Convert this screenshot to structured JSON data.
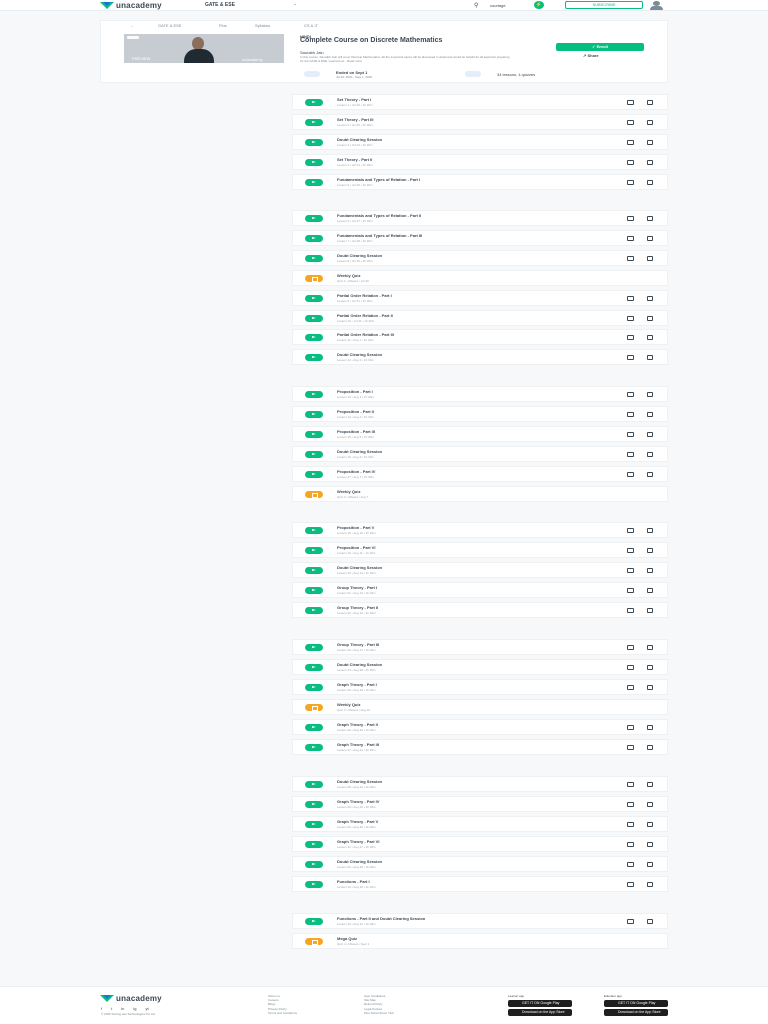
{
  "header": {
    "logo_text": "unacademy",
    "goal": "GATE & ESE",
    "goal_chevron": "⌄",
    "search_placeholder": "courtage",
    "subscribe_label": "SUBSCRIBE"
  },
  "breadcrumbs": [
    "←",
    "GATE & ESE",
    "Plus",
    "Syllabus",
    "CS & IT"
  ],
  "course": {
    "thumb_preview": "PREVIEW",
    "thumb_brand": "unacademy",
    "language": "HINDI",
    "title": "Complete Course on Discrete Mathematics",
    "author": "Saurabh Jain",
    "description": "In this course, Saurabh Jain will cover Discrete Mathematics. All the important topics will be discussed in detail and would be helpful for all aspirants preparing for the GATE & ESE. Learners at... Read more",
    "enroll_label": "Enroll",
    "share_label": "Share",
    "ended_label": "Ended on Sept 1",
    "ended_sub": "Jul 20, 2020 - Sept 1, 2020",
    "lessons_label": "34 lessons, 4 quizzes"
  },
  "groups": [
    [
      {
        "type": "video",
        "title": "Set Theory - Part I",
        "sub": "Lesson 1  •  Jul 20  •  1h 30m"
      },
      {
        "type": "video",
        "title": "Set Theory - Part III",
        "sub": "Lesson 2  •  Jul 20  •  1h 30m"
      },
      {
        "type": "video",
        "title": "Doubt Clearing Session",
        "sub": "Lesson 3  •  Jul 23  •  1h 30m"
      },
      {
        "type": "video",
        "title": "Set Theory - Part II",
        "sub": "Lesson 4  •  Jul 24  •  1h 30m"
      },
      {
        "type": "video",
        "title": "Fundamentals and Types of Relation - Part I",
        "sub": "Lesson 5  •  Jul 26  •  1h 30m"
      }
    ],
    [
      {
        "type": "video",
        "title": "Fundamentals and Types of Relation - Part II",
        "sub": "Lesson 6  •  Jul 27  •  1h 30m"
      },
      {
        "type": "video",
        "title": "Fundamentals and Types of Relation - Part III",
        "sub": "Lesson 7  •  Jul 28  •  1h 30m"
      },
      {
        "type": "video",
        "title": "Doubt Clearing Session",
        "sub": "Lesson 8  •  Jul 30  •  1h 30m"
      },
      {
        "type": "quiz",
        "title": "Weekly Quiz",
        "sub": "Quiz 1  •  Missed  •  Jul 30"
      },
      {
        "type": "video",
        "title": "Partial Order Relation - Part I",
        "sub": "Lesson 9  •  Jul 31  •  1h 30m"
      },
      {
        "type": "video",
        "title": "Partial Order Relation - Part II",
        "sub": "Lesson 10  •  Jul 31  •  1h 30m"
      },
      {
        "type": "video",
        "title": "Partial Order Relation - Part III",
        "sub": "Lesson 11  •  Aug 1  •  1h 30m"
      },
      {
        "type": "video",
        "title": "Doubt Clearing Session",
        "sub": "Lesson 12  •  Aug 2  •  1h 30m"
      }
    ],
    [
      {
        "type": "video",
        "title": "Proposition - Part I",
        "sub": "Lesson 13  •  Aug 3  •  1h 30m"
      },
      {
        "type": "video",
        "title": "Proposition - Part II",
        "sub": "Lesson 14  •  Aug 4  •  1h 30m"
      },
      {
        "type": "video",
        "title": "Proposition - Part III",
        "sub": "Lesson 15  •  Aug 5  •  1h 30m"
      },
      {
        "type": "video",
        "title": "Doubt Clearing Session",
        "sub": "Lesson 16  •  Aug 6  •  1h 30m"
      },
      {
        "type": "video",
        "title": "Proposition - Part IV",
        "sub": "Lesson 17  •  Aug 7  •  1h 30m"
      },
      {
        "type": "quiz",
        "title": "Weekly Quiz",
        "sub": "Quiz 2  •  Missed  •  Aug 7"
      }
    ],
    [
      {
        "type": "video",
        "title": "Proposition - Part V",
        "sub": "Lesson 18  •  Aug 10  •  1h 30m"
      },
      {
        "type": "video",
        "title": "Proposition - Part VI",
        "sub": "Lesson 19  •  Aug 11  •  1h 30m"
      },
      {
        "type": "video",
        "title": "Doubt Clearing Session",
        "sub": "Lesson 20  •  Aug 13  •  1h 30m"
      },
      {
        "type": "video",
        "title": "Group Theory - Part I",
        "sub": "Lesson 21  •  Aug 14  •  1h 30m"
      },
      {
        "type": "video",
        "title": "Group Theory - Part II",
        "sub": "Lesson 22  •  Aug 14  •  1h 30m"
      }
    ],
    [
      {
        "type": "video",
        "title": "Group Theory - Part III",
        "sub": "Lesson 23  •  Aug 17  •  1h 30m"
      },
      {
        "type": "video",
        "title": "Doubt Clearing Session",
        "sub": "Lesson 24  •  Aug 18  •  1h 30m"
      },
      {
        "type": "video",
        "title": "Graph Theory - Part I",
        "sub": "Lesson 25  •  Aug 19  •  1h 30m"
      },
      {
        "type": "quiz",
        "title": "Weekly Quiz",
        "sub": "Quiz 3  •  Missed  •  Aug 19"
      },
      {
        "type": "video",
        "title": "Graph Theory - Part II",
        "sub": "Lesson 26  •  Aug 20  •  1h 30m"
      },
      {
        "type": "video",
        "title": "Graph Theory - Part III",
        "sub": "Lesson 27  •  Aug 21  •  1h 30m"
      }
    ],
    [
      {
        "type": "video",
        "title": "Doubt Clearing Session",
        "sub": "Lesson 28  •  Aug 24  •  1h 30m"
      },
      {
        "type": "video",
        "title": "Graph Theory - Part IV",
        "sub": "Lesson 29  •  Aug 25  •  1h 30m"
      },
      {
        "type": "video",
        "title": "Graph Theory - Part V",
        "sub": "Lesson 30  •  Aug 26  •  1h 30m"
      },
      {
        "type": "video",
        "title": "Graph Theory - Part VI",
        "sub": "Lesson 31  •  Aug 27  •  1h 30m"
      },
      {
        "type": "video",
        "title": "Doubt Clearing Session",
        "sub": "Lesson 32  •  Aug 28  •  1h 30m"
      },
      {
        "type": "video",
        "title": "Functions - Part I",
        "sub": "Lesson 33  •  Aug 29  •  1h 30m"
      }
    ],
    [
      {
        "type": "video",
        "title": "Functions - Part II and Doubt Clearing Session",
        "sub": "Lesson 34  •  Aug 31  •  1h 30m"
      },
      {
        "type": "quiz",
        "title": "Mega Quiz",
        "sub": "Quiz 4  •  Missed  •  Sept 1"
      }
    ]
  ],
  "footer": {
    "logo_text": "unacademy",
    "social": [
      "f",
      "t",
      "in",
      "ig",
      "yt"
    ],
    "copyright": "© 2020 Sorting Hat Technologies Pvt Ltd",
    "col1": [
      "About us",
      "Careers",
      "Blogs",
      "Privacy Policy",
      "Terms and Conditions"
    ],
    "col2": [
      "User Guidelines",
      "Site Map",
      "Refund Policy",
      "Legal Notices",
      "Plus Subscription T&C"
    ],
    "learner_app_label": "Learner app",
    "educator_app_label": "Educator app",
    "google_play": "GET IT ON Google Play",
    "app_store": "Download on the App Store"
  },
  "colors": {
    "accent": "#08bd80",
    "quiz": "#f5a623",
    "text": "#3c4852"
  }
}
